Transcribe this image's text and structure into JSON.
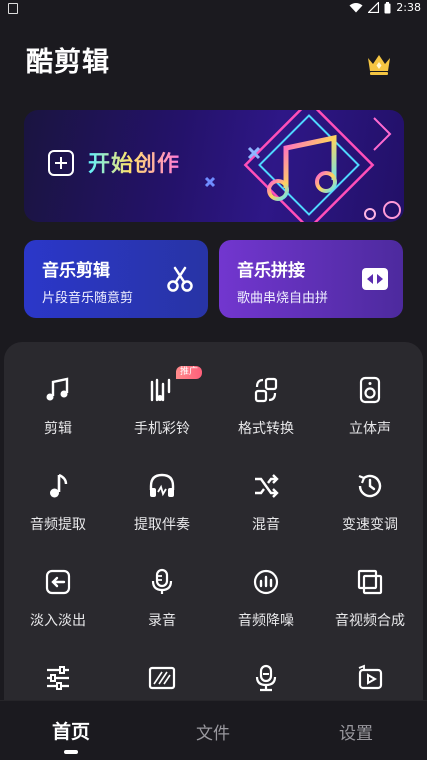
{
  "status_bar": {
    "time": "2:38",
    "icons": [
      "notification-icon",
      "wifi-icon",
      "signal-icon",
      "battery-icon"
    ]
  },
  "header": {
    "title": "酷剪辑",
    "vip_icon": "crown-icon",
    "crown_color": "#f5c542"
  },
  "hero": {
    "label": "开始创作",
    "icon": "plus-square-icon"
  },
  "features": [
    {
      "title": "音乐剪辑",
      "subtitle": "片段音乐随意剪",
      "icon": "scissors-icon"
    },
    {
      "title": "音乐拼接",
      "subtitle": "歌曲串烧自由拼",
      "icon": "merge-icon"
    }
  ],
  "tools": [
    {
      "label": "剪辑",
      "icon": "music-note-icon"
    },
    {
      "label": "手机彩铃",
      "icon": "ringtone-icon",
      "badge": "推广"
    },
    {
      "label": "格式转换",
      "icon": "convert-icon"
    },
    {
      "label": "立体声",
      "icon": "speaker-icon"
    },
    {
      "label": "音频提取",
      "icon": "eighth-note-icon"
    },
    {
      "label": "提取伴奏",
      "icon": "headphones-icon"
    },
    {
      "label": "混音",
      "icon": "shuffle-icon"
    },
    {
      "label": "变速变调",
      "icon": "speed-icon"
    },
    {
      "label": "淡入淡出",
      "icon": "fade-icon"
    },
    {
      "label": "录音",
      "icon": "microphone-icon"
    },
    {
      "label": "音频降噪",
      "icon": "denoise-icon"
    },
    {
      "label": "音视频合成",
      "icon": "av-merge-icon"
    },
    {
      "label": "",
      "icon": "equalizer-icon"
    },
    {
      "label": "",
      "icon": "film-icon"
    },
    {
      "label": "",
      "icon": "voice-change-icon"
    },
    {
      "label": "",
      "icon": "video-loop-icon"
    }
  ],
  "tabs": [
    {
      "label": "首页",
      "active": true
    },
    {
      "label": "文件",
      "active": false
    },
    {
      "label": "设置",
      "active": false
    }
  ]
}
